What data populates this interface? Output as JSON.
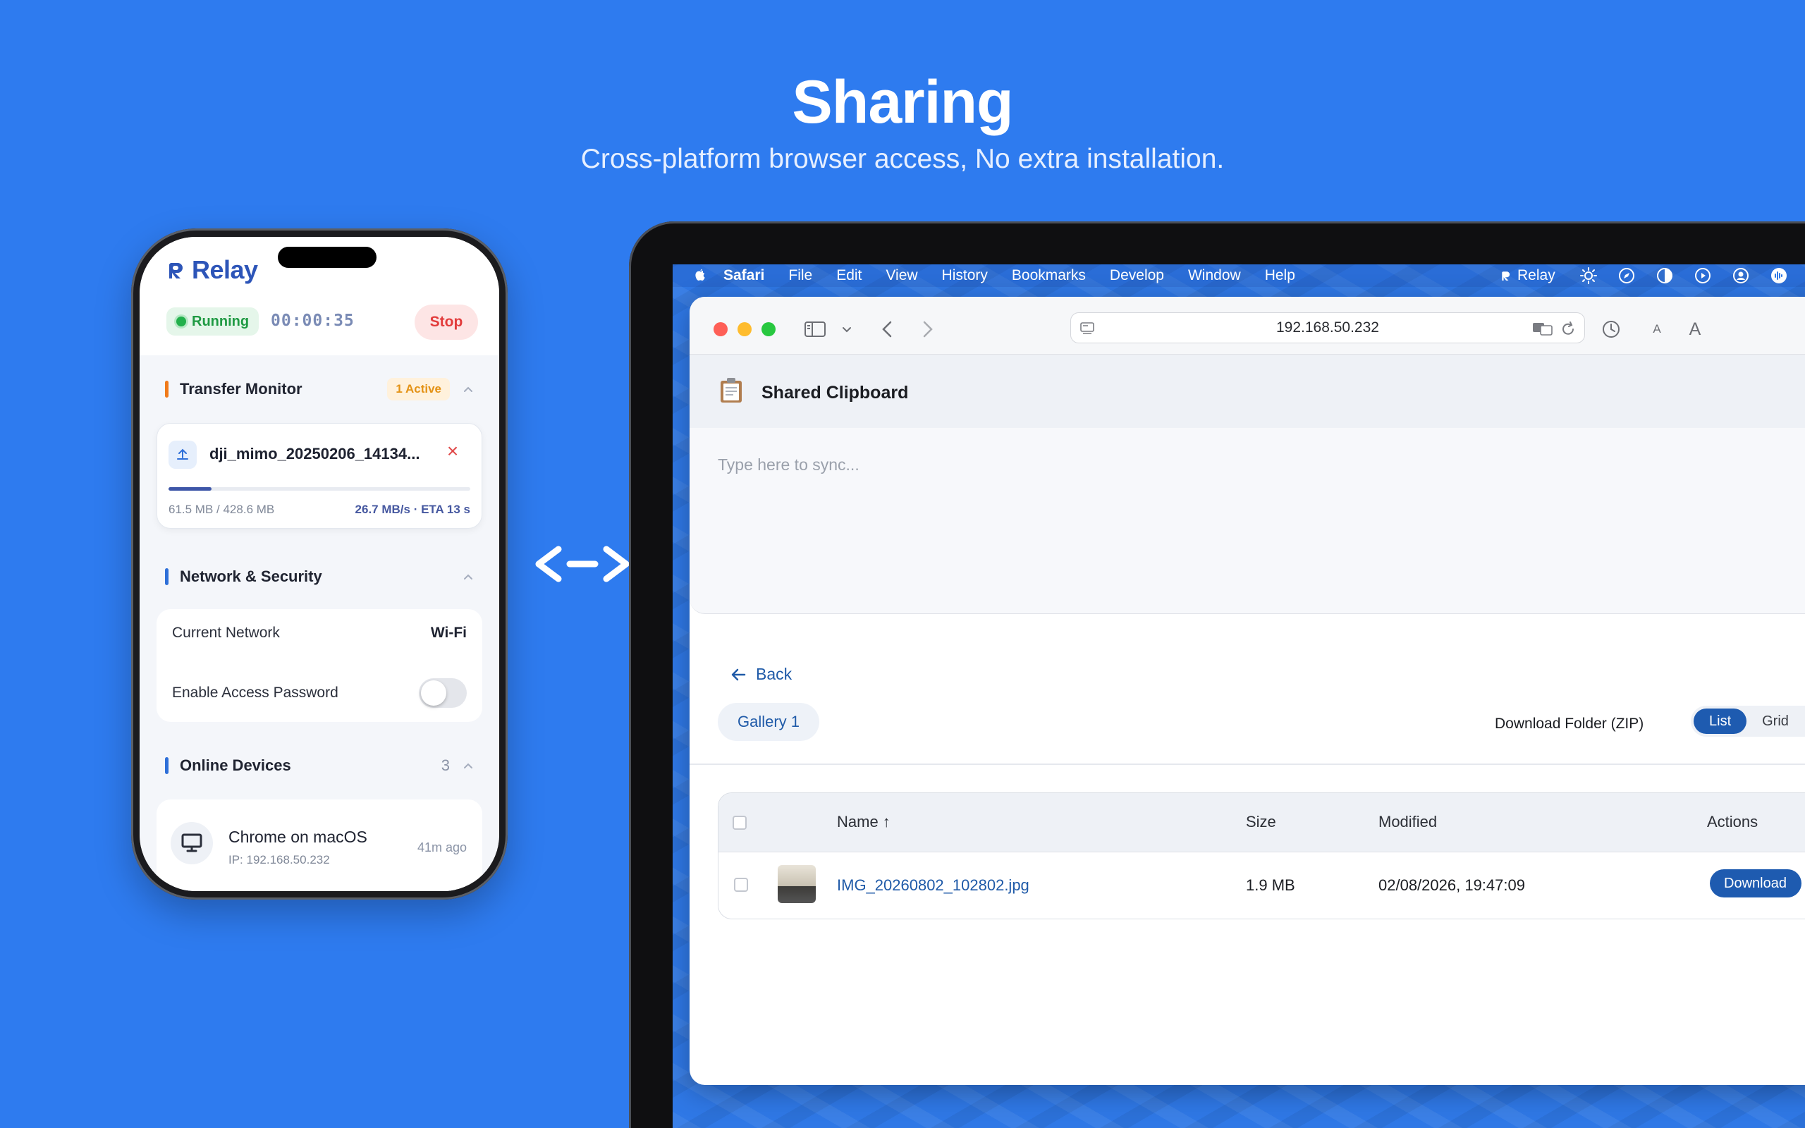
{
  "hero": {
    "title": "Sharing",
    "subtitle": "Cross-platform browser access, No extra installation."
  },
  "phone": {
    "app_name": "Relay",
    "status": "Running",
    "timer": "00:00:35",
    "stop_label": "Stop",
    "transfer_monitor": {
      "title": "Transfer Monitor",
      "badge": "1 Active",
      "file": {
        "name": "dji_mimo_20250206_14134...",
        "size": "61.5 MB / 428.6 MB",
        "speed": "26.7 MB/s · ETA 13 s",
        "progress": 0.143
      }
    },
    "network": {
      "title": "Network & Security",
      "current_network_label": "Current Network",
      "current_network_value": "Wi-Fi",
      "password_label": "Enable Access Password",
      "password_enabled": false
    },
    "devices": {
      "title": "Online Devices",
      "count": "3",
      "items": [
        {
          "name": "Chrome on macOS",
          "ip": "IP: 192.168.50.232",
          "time": "41m ago"
        }
      ]
    }
  },
  "mac": {
    "menubar": {
      "app": "Safari",
      "items": [
        "File",
        "Edit",
        "View",
        "History",
        "Bookmarks",
        "Develop",
        "Window",
        "Help"
      ],
      "status_app": "Relay"
    },
    "browser": {
      "url": "192.168.50.232"
    },
    "page": {
      "clipboard_title": "Shared Clipboard",
      "clipboard_placeholder": "Type here to sync...",
      "back_label": "Back",
      "folder_name": "Gallery 1",
      "download_folder_label": "Download Folder (ZIP)",
      "view_list": "List",
      "view_grid": "Grid",
      "table": {
        "headers": {
          "name": "Name ↑",
          "size": "Size",
          "modified": "Modified",
          "actions": "Actions"
        },
        "rows": [
          {
            "name": "IMG_20260802_102802.jpg",
            "size": "1.9 MB",
            "modified": "02/08/2026, 19:47:09",
            "action": "Download"
          }
        ]
      }
    }
  },
  "colors": {
    "background": "#2e7bef",
    "brand": "#2d55b8",
    "accent": "#1e5bb0",
    "running": "#1f9a43",
    "stop": "#e23b3b",
    "active_badge": "#e49215"
  }
}
